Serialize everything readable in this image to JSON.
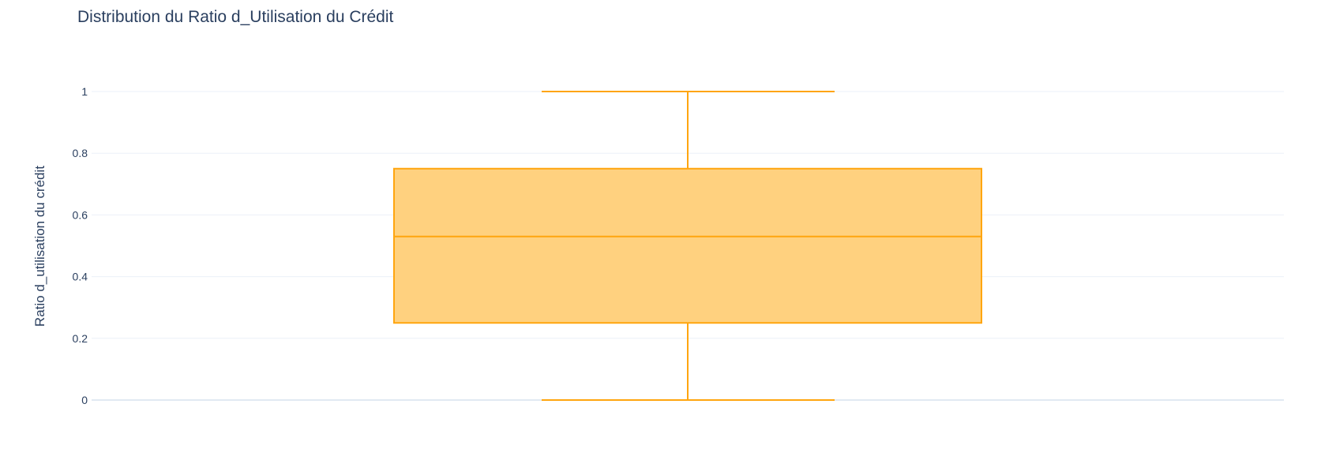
{
  "chart_data": {
    "type": "box",
    "title": "Distribution du Ratio d_Utilisation du Crédit",
    "xlabel": "",
    "ylabel": "Ratio d_utilisation du crédit",
    "ylim": [
      0,
      1
    ],
    "yticks": [
      0,
      0.2,
      0.4,
      0.6,
      0.8,
      1
    ],
    "ytick_labels": [
      "0",
      "0.2",
      "0.4",
      "0.6",
      "0.8",
      "1"
    ],
    "grid": true,
    "legend": "none",
    "series": [
      {
        "min": 0,
        "q1": 0.25,
        "median": 0.53,
        "q3": 0.75,
        "max": 1
      }
    ],
    "colors": {
      "box_line": "#ffa50f",
      "box_fill": "#ffd17f",
      "grid": "#ebf0f8",
      "zeroline": "#e1e9f2",
      "text": "#2a3f5f"
    }
  }
}
